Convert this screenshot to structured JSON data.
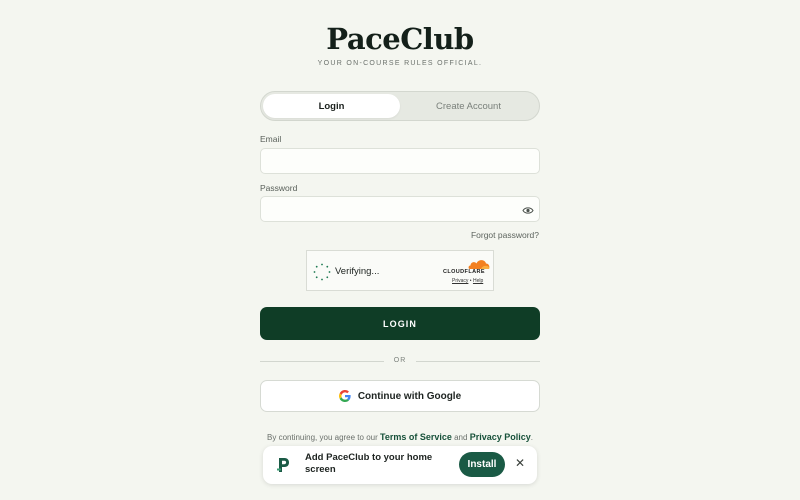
{
  "brand": {
    "name": "PaceClub",
    "tagline": "YOUR ON-COURSE RULES OFFICIAL."
  },
  "tabs": [
    {
      "label": "Login",
      "active": true
    },
    {
      "label": "Create Account",
      "active": false
    }
  ],
  "form": {
    "email_label": "Email",
    "email_value": "",
    "password_label": "Password",
    "password_value": "",
    "password_toggle_icon": "eye-icon",
    "forgot_password": "Forgot password?"
  },
  "captcha": {
    "status": "Verifying...",
    "provider": "CLOUDFLARE",
    "privacy": "Privacy",
    "separator": "•",
    "help": "Help"
  },
  "login_button": "LOGIN",
  "divider_text": "OR",
  "google_button": {
    "label": "Continue with Google",
    "icon": "google-icon"
  },
  "terms": {
    "prefix": "By continuing, you agree to our",
    "tos": "Terms of Service",
    "and": "and",
    "privacy": "Privacy Policy",
    "suffix": "."
  },
  "install_banner": {
    "text": "Add PaceClub to your home screen",
    "install": "Install",
    "close": "✕"
  },
  "colors": {
    "background": "#f4f6f0",
    "primary": "#0f3d26",
    "accent": "#1a5a45",
    "link": "#17513a",
    "cloudflare": "#f38020"
  }
}
